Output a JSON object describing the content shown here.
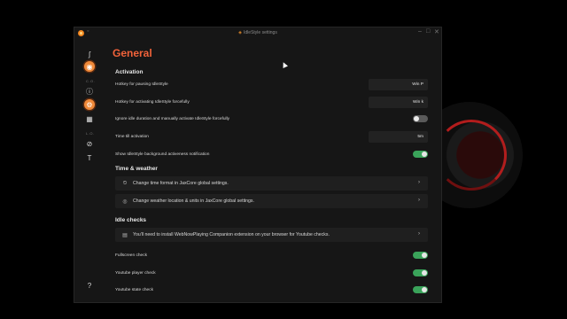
{
  "window": {
    "title_icon": "palette-icon",
    "title": "IdleStyle settings",
    "back_glyph": "◦",
    "minimize_glyph": "–",
    "maximize_glyph": "□",
    "close_glyph": "✕"
  },
  "sidebar": {
    "items": [
      {
        "name": "jaxcore-icon",
        "glyph": "ʃ"
      },
      {
        "name": "idlestyle-icon",
        "glyph": "◉"
      },
      {
        "name": "info-icon",
        "glyph": "ⓘ"
      },
      {
        "name": "settings-gear-icon",
        "glyph": "⚙"
      },
      {
        "name": "widgets-icon",
        "glyph": "▦"
      },
      {
        "name": "link-icon",
        "glyph": "⊘"
      },
      {
        "name": "text-tool-icon",
        "glyph": "T"
      },
      {
        "name": "help-icon",
        "glyph": "?"
      }
    ],
    "categories": [
      "C.O.",
      "L.O."
    ]
  },
  "page": {
    "title": "General",
    "activation": {
      "heading": "Activation",
      "hotkey_pause_label": "Hotkey for pausing IdleStyle",
      "hotkey_pause_value": "Win P",
      "hotkey_activate_label": "Hotkey for activating IdleStyle forcefully",
      "hotkey_activate_value": "Win k",
      "ignore_idle_label": "Ignore idle duration and manually activate IdleStyle forcefully",
      "ignore_idle_on": false,
      "time_till_label": "Time till activation",
      "time_till_value": "5m",
      "show_notification_label": "Show IdleStyle background activeness notification",
      "show_notification_on": true
    },
    "time_weather": {
      "heading": "Time & weather",
      "time_format_text": "Change time format in JaxCore global settings.",
      "weather_text": "Change weather location & units in JaxCore global settings.",
      "chevron": "›"
    },
    "idle_checks": {
      "heading": "Idle checks",
      "info_text": "You'll need to install WebNowPlaying Companion extension on your browser for Youtube checks.",
      "fullscreen_label": "Fullscreen check",
      "fullscreen_on": true,
      "yt_player_label": "Youtube player check",
      "yt_player_on": true,
      "yt_state_label": "Youtube state check",
      "yt_state_on": true
    }
  },
  "colors": {
    "accent": "#f0623a",
    "toggle_on": "#3aa35a",
    "window_bg": "#161616"
  }
}
